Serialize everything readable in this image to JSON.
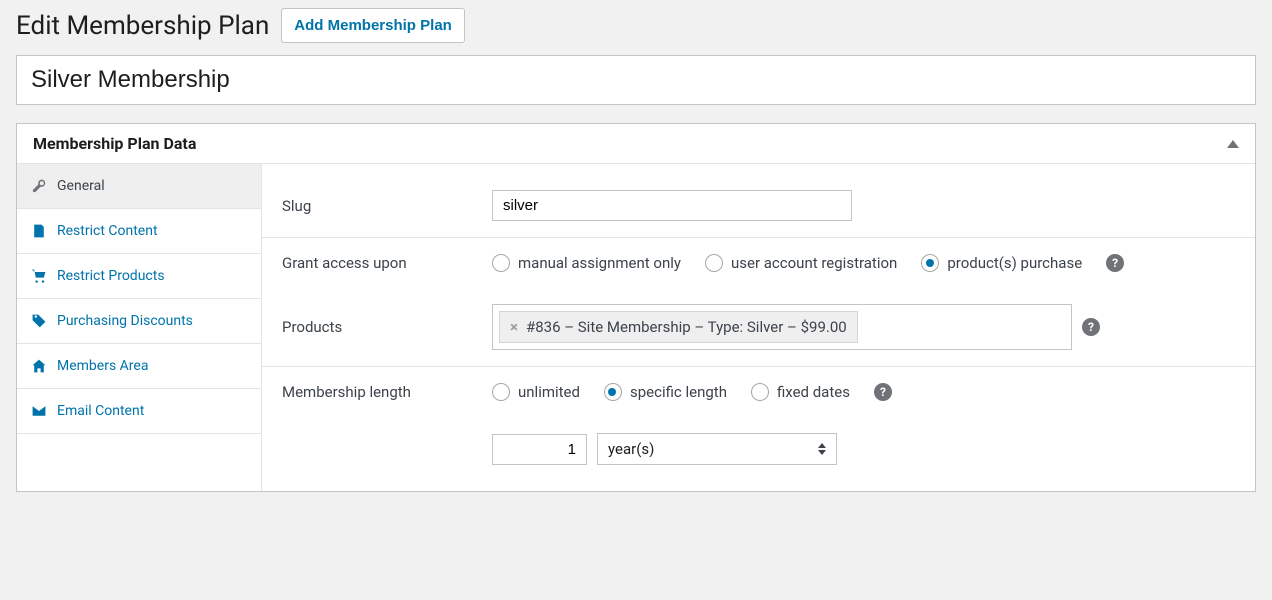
{
  "header": {
    "title": "Edit Membership Plan",
    "add_button": "Add Membership Plan"
  },
  "title_input": "Silver Membership",
  "panel": {
    "title": "Membership Plan Data"
  },
  "tabs": [
    {
      "key": "general",
      "label": "General",
      "icon": "wrench",
      "active": true
    },
    {
      "key": "restrict-content",
      "label": "Restrict Content",
      "icon": "doc",
      "active": false
    },
    {
      "key": "restrict-products",
      "label": "Restrict Products",
      "icon": "cart",
      "active": false
    },
    {
      "key": "purchasing-discounts",
      "label": "Purchasing Discounts",
      "icon": "tag",
      "active": false
    },
    {
      "key": "members-area",
      "label": "Members Area",
      "icon": "home",
      "active": false
    },
    {
      "key": "email-content",
      "label": "Email Content",
      "icon": "mail",
      "active": false
    }
  ],
  "form": {
    "slug": {
      "label": "Slug",
      "value": "silver"
    },
    "grant_access": {
      "label": "Grant access upon",
      "options": [
        {
          "key": "manual",
          "label": "manual assignment only",
          "checked": false
        },
        {
          "key": "register",
          "label": "user account registration",
          "checked": false
        },
        {
          "key": "purchase",
          "label": "product(s) purchase",
          "checked": true
        }
      ]
    },
    "products": {
      "label": "Products",
      "tokens": [
        {
          "label": "#836 – Site Membership – Type: Silver – $99.00"
        }
      ]
    },
    "length": {
      "label": "Membership length",
      "options": [
        {
          "key": "unlimited",
          "label": "unlimited",
          "checked": false
        },
        {
          "key": "specific",
          "label": "specific length",
          "checked": true
        },
        {
          "key": "fixed",
          "label": "fixed dates",
          "checked": false
        }
      ],
      "number": "1",
      "unit": "year(s)"
    }
  }
}
